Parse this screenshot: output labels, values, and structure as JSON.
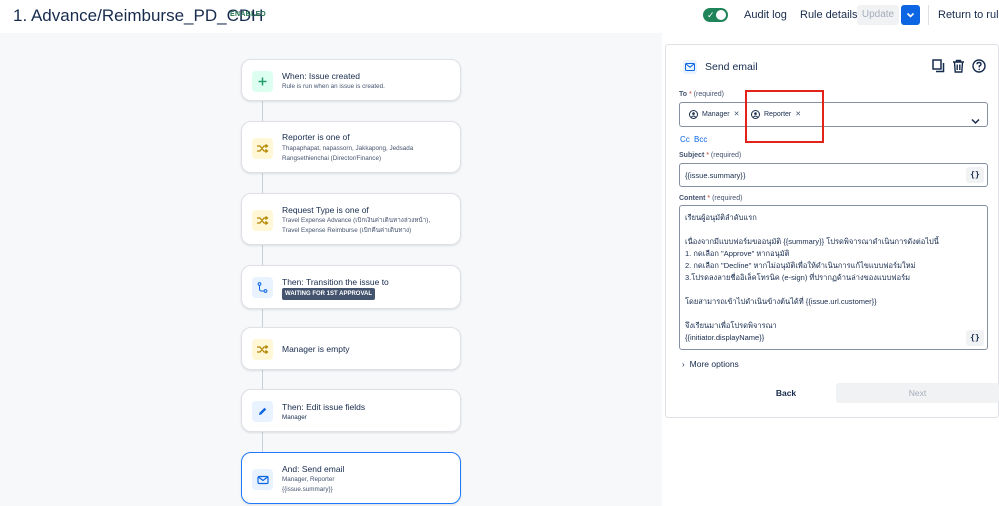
{
  "header": {
    "title": "1. Advance/Reimburse_PD_CDH",
    "status": "ENABLED",
    "audit_log": "Audit log",
    "rule_details": "Rule details",
    "update": "Update",
    "return": "Return to rules"
  },
  "rules": [
    {
      "title": "When: Issue created",
      "sub": [
        "Rule is run when an issue is created."
      ],
      "icon": "plus-icon",
      "color": "green"
    },
    {
      "title": "Reporter is one of",
      "sub": [
        "Thapaphapat, napassorn, Jakkapong, Jedsada",
        "Rangsethienchai (Director/Finance)"
      ],
      "icon": "shuffle-icon",
      "color": "yellow"
    },
    {
      "title": "Request Type is one of",
      "sub": [
        "Travel Expense Advance (เบิกเงินค่าเดินทางล่วงหน้า),",
        "Travel Expense Reimburse (เบิกคืนค่าเดินทาง)"
      ],
      "icon": "shuffle-icon",
      "color": "yellow"
    },
    {
      "title": "Then: Transition the issue to",
      "lozenge": "WAITING FOR 1ST APPROVAL",
      "icon": "transition-icon",
      "color": "blue"
    },
    {
      "title": "Manager is empty",
      "sub": [],
      "icon": "shuffle-icon",
      "color": "yellow"
    },
    {
      "title": "Then: Edit issue fields",
      "sub": [
        "Manager"
      ],
      "icon": "pencil-icon",
      "color": "blue"
    },
    {
      "title": "And: Send email",
      "sub": [
        "Manager, Reporter",
        "{{issue.summary}}"
      ],
      "icon": "envelope-icon",
      "color": "blue"
    }
  ],
  "panel": {
    "title": "Send email",
    "to_label": "To",
    "to_req": "(required)",
    "to_chips": [
      "Manager",
      "Reporter"
    ],
    "cc": "Cc",
    "bcc": "Bcc",
    "subject_label": "Subject",
    "subject_req": "(required)",
    "subject_value": "{{issue.summary}}",
    "content_label": "Content",
    "content_req": "(required)",
    "content_lines": [
      "เรียนผู้อนุมัติลำดับแรก",
      "",
      "เนื่องจากมีแบบฟอร์มขออนุมัติ {{summary}} โปรดพิจารณาดำเนินการดังต่อไปนี้",
      "1. กดเลือก \"Approve\" หากอนุมัติ",
      "2. กดเลือก \"Decline\" หากไม่อนุมัติเพื่อให้ดำเนินการแก้ไขแบบฟอร์มใหม่",
      "3.โปรดลงลายชื่ออิเล็คโทรนิค (e-sign) ที่ปรากฏด้านล่างของแบบฟอร์ม",
      "",
      "โดยสามารถเข้าไปดำเนินข้างต้นได้ที่ {{issue.url.customer}}",
      "",
      "จึงเรียนมาเพื่อโปรดพิจารณา",
      "{{initiator.displayName}}"
    ],
    "braces": "{}",
    "more_options": "More options",
    "back": "Back",
    "next": "Next"
  },
  "colors": {
    "accent": "#0c66e4",
    "enabled": "#1f845a",
    "highlight": "#e2231a"
  }
}
